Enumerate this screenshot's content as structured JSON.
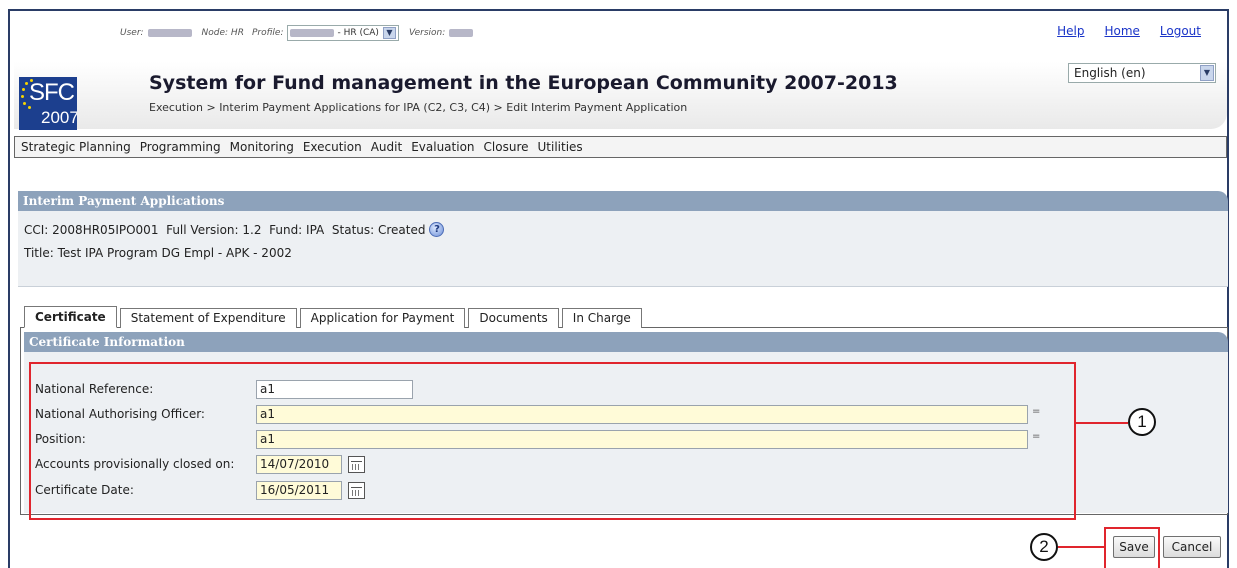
{
  "topbar": {
    "user_label": "User:",
    "node_label": "Node: HR",
    "profile_label": "Profile:",
    "profile_value": "- HR (CA)",
    "version_label": "Version:"
  },
  "links": {
    "help": "Help",
    "home": "Home",
    "logout": "Logout"
  },
  "logo": {
    "text": "SFC",
    "year": "2007"
  },
  "system_title": "System for Fund management in the European Community 2007-2013",
  "breadcrumb": "Execution > Interim Payment Applications for IPA (C2, C3, C4) > Edit Interim Payment Application",
  "language": "English (en)",
  "menu": [
    "Strategic Planning",
    "Programming",
    "Monitoring",
    "Execution",
    "Audit",
    "Evaluation",
    "Closure",
    "Utilities"
  ],
  "panel": {
    "title": "Interim Payment Applications",
    "line1": "CCI: 2008HR05IPO001  Full Version: 1.2  Fund: IPA  Status: Created",
    "line2": "Title: Test IPA Program DG Empl - APK - 2002"
  },
  "tabs": [
    "Certificate",
    "Statement of Expenditure",
    "Application for Payment",
    "Documents",
    "In Charge"
  ],
  "certificate": {
    "title": "Certificate Information",
    "national_reference_label": "National Reference:",
    "national_reference_value": "a1",
    "officer_label": "National Authorising Officer:",
    "officer_value": "a1",
    "position_label": "Position:",
    "position_value": "a1",
    "accounts_label": "Accounts provisionally closed on:",
    "accounts_value": "14/07/2010",
    "cert_date_label": "Certificate Date:",
    "cert_date_value": "16/05/2011",
    "required_mark": "="
  },
  "callouts": {
    "one": "1",
    "two": "2"
  },
  "buttons": {
    "save": "Save",
    "cancel": "Cancel"
  },
  "colors": {
    "panel_header": "#8da2bb",
    "annotation_red": "#e0252d",
    "link_blue": "#1a34c8"
  }
}
